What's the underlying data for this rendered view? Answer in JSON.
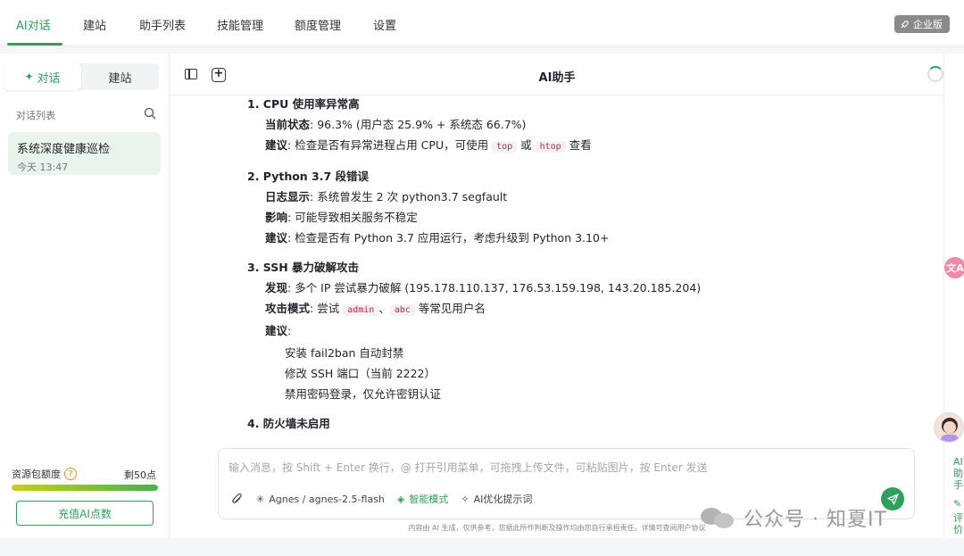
{
  "topnav": {
    "tabs": [
      "AI对话",
      "建站",
      "助手列表",
      "技能管理",
      "额度管理",
      "设置"
    ],
    "active_tab": "AI对话",
    "edition_badge": "企业版"
  },
  "sidebar": {
    "segments": [
      "对话",
      "建站"
    ],
    "list_title": "对话列表",
    "conversations": [
      {
        "title": "系统深度健康巡检",
        "time": "今天 13:47"
      }
    ],
    "quota": {
      "label": "资源包额度",
      "help": "?",
      "remaining": "剩50点",
      "fill_fraction": 1.0
    },
    "recharge_button": "充值AI点数"
  },
  "main": {
    "title": "AI助手",
    "sections": [
      {
        "heading": "1. CPU 使用率异常高",
        "lines": [
          {
            "label": "当前状态",
            "text": ": 96.3% (用户态 25.9% + 系统态 66.7%)"
          },
          {
            "label": "建议",
            "text_a": ": 检查是否有异常进程占用 CPU，可使用 ",
            "code1": "top",
            "mid": " 或 ",
            "code2": "htop",
            "text_b": " 查看"
          }
        ]
      },
      {
        "heading": "2. Python 3.7 段错误",
        "lines": [
          {
            "label": "日志显示",
            "text": ": 系统曾发生 2 次 python3.7 segfault"
          },
          {
            "label": "影响",
            "text": ": 可能导致相关服务不稳定"
          },
          {
            "label": "建议",
            "text": ": 检查是否有 Python 3.7 应用运行，考虑升级到 Python 3.10+"
          }
        ]
      },
      {
        "heading": "3. SSH 暴力破解攻击",
        "lines": [
          {
            "label": "发现",
            "text": ": 多个 IP 尝试暴力破解 (195.178.110.137, 176.53.159.198, 143.20.185.204)"
          },
          {
            "label": "攻击模式",
            "text_a": ": 尝试 ",
            "code1": "admin",
            "mid": "、",
            "code2": "abc",
            "text_b": " 等常见用户名"
          },
          {
            "label": "建议",
            "text": ":"
          }
        ],
        "subitems": [
          "安装 fail2ban 自动封禁",
          "修改 SSH 端口（当前 2222）",
          "禁用密码登录，仅允许密钥认证"
        ]
      },
      {
        "heading": "4. 防火墙未启用"
      }
    ],
    "composer": {
      "placeholder": "输入消息，按 Shift + Enter 换行，@ 打开引用菜单，可拖拽上传文件，可粘贴图片，按 Enter 发送",
      "model": "Agnes / agnes-2.5-flash",
      "smart_mode": "智能模式",
      "optimize": "AI优化提示词"
    },
    "disclaimer": "内容由 AI 生成，仅供参考，您据此所作判断及操作均由您自行承担责任，详情可查阅用户协议"
  },
  "rail": {
    "assistant": "AI助手",
    "review": "评价"
  },
  "watermark": "公众号 · 知夏IT",
  "colors": {
    "accent": "#2ea05a",
    "code": "#c7254e"
  }
}
